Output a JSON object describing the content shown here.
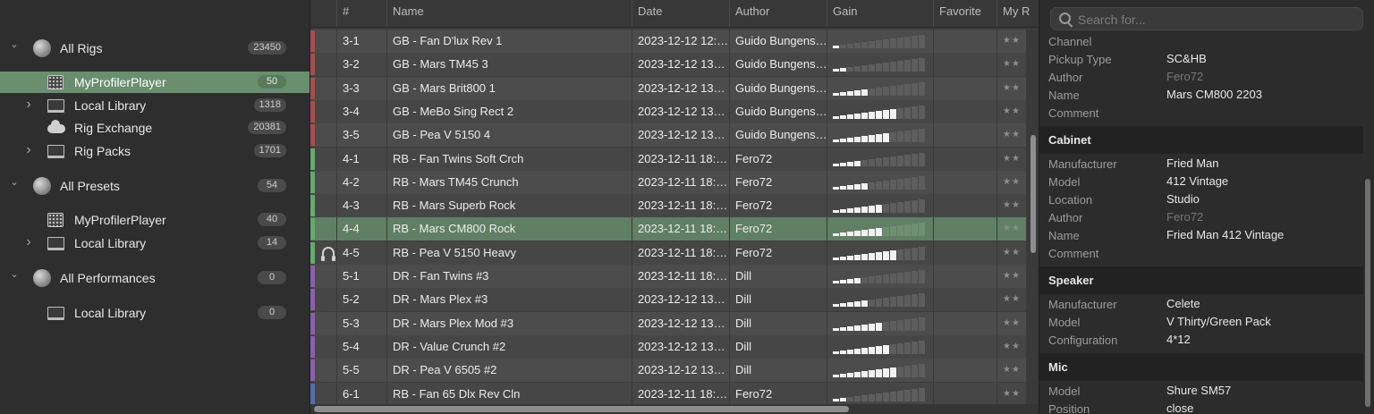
{
  "sidebar": {
    "items": [
      {
        "label": "All Rigs",
        "count": "23450",
        "icon": "globe-icon",
        "chevron": "down",
        "indent": 0,
        "selected": false
      },
      {
        "label": "MyProfilerPlayer",
        "count": "50",
        "icon": "profiler-device-icon",
        "chevron": "",
        "indent": 1,
        "selected": true
      },
      {
        "label": "Local Library",
        "count": "1318",
        "icon": "laptop-icon",
        "chevron": "right",
        "indent": 1,
        "selected": false
      },
      {
        "label": "Rig Exchange",
        "count": "20381",
        "icon": "cloud-icon",
        "chevron": "",
        "indent": 1,
        "selected": false
      },
      {
        "label": "Rig Packs",
        "count": "1701",
        "icon": "laptop-icon",
        "chevron": "right",
        "indent": 1,
        "selected": false
      },
      {
        "label": "All Presets",
        "count": "54",
        "icon": "globe-icon",
        "chevron": "down",
        "indent": 0,
        "selected": false
      },
      {
        "label": "MyProfilerPlayer",
        "count": "40",
        "icon": "profiler-device-icon",
        "chevron": "",
        "indent": 1,
        "selected": false
      },
      {
        "label": "Local Library",
        "count": "14",
        "icon": "laptop-icon",
        "chevron": "right",
        "indent": 1,
        "selected": false
      },
      {
        "label": "All Performances",
        "count": "0",
        "icon": "globe-icon",
        "chevron": "down",
        "indent": 0,
        "selected": false
      },
      {
        "label": "Local Library",
        "count": "0",
        "icon": "laptop-icon",
        "chevron": "",
        "indent": 1,
        "selected": false
      }
    ]
  },
  "table": {
    "columns": [
      "#",
      "Name",
      "Date",
      "Author",
      "Gain",
      "Favorite",
      "My R"
    ],
    "rows": [
      {
        "num": "3-1",
        "name": "GB - Fan D'lux Rev 1",
        "date": "2023-12-12 12:…",
        "author": "Guido Bungens…",
        "gain": 0.1,
        "color": "#b04a4a",
        "selected": false,
        "icon": ""
      },
      {
        "num": "3-2",
        "name": "GB - Mars TM45 3",
        "date": "2023-12-12 13…",
        "author": "Guido Bungens…",
        "gain": 0.18,
        "color": "#b04a4a",
        "selected": false,
        "icon": ""
      },
      {
        "num": "3-3",
        "name": "GB - Mars Brit800 1",
        "date": "2023-12-12 13…",
        "author": "Guido Bungens…",
        "gain": 0.4,
        "color": "#b04a4a",
        "selected": false,
        "icon": ""
      },
      {
        "num": "3-4",
        "name": "GB - MeBo Sing Rect 2",
        "date": "2023-12-12 13…",
        "author": "Guido Bungens…",
        "gain": 0.7,
        "color": "#b04a4a",
        "selected": false,
        "icon": ""
      },
      {
        "num": "3-5",
        "name": "GB - Pea V 5150 4",
        "date": "2023-12-12 13…",
        "author": "Guido Bungens…",
        "gain": 0.62,
        "color": "#b04a4a",
        "selected": false,
        "icon": ""
      },
      {
        "num": "4-1",
        "name": "RB - Fan Twins Soft Crch",
        "date": "2023-12-11 18:…",
        "author": "Fero72",
        "gain": 0.3,
        "color": "#5fae6a",
        "selected": false,
        "icon": ""
      },
      {
        "num": "4-2",
        "name": "RB - Mars TM45 Crunch",
        "date": "2023-12-11 18:…",
        "author": "Fero72",
        "gain": 0.4,
        "color": "#5fae6a",
        "selected": false,
        "icon": ""
      },
      {
        "num": "4-3",
        "name": "RB - Mars Superb Rock",
        "date": "2023-12-11 18:…",
        "author": "Fero72",
        "gain": 0.5,
        "color": "#5fae6a",
        "selected": false,
        "icon": ""
      },
      {
        "num": "4-4",
        "name": "RB - Mars CM800 Rock",
        "date": "2023-12-11 18:…",
        "author": "Fero72",
        "gain": 0.55,
        "color": "#5fae6a",
        "selected": true,
        "icon": ""
      },
      {
        "num": "4-5",
        "name": "RB - Pea V 5150 Heavy",
        "date": "2023-12-11 18:…",
        "author": "Fero72",
        "gain": 0.72,
        "color": "#5fae6a",
        "selected": false,
        "icon": "headphones-icon"
      },
      {
        "num": "5-1",
        "name": "DR - Fan Twins #3",
        "date": "2023-12-11 18:…",
        "author": "Dill",
        "gain": 0.3,
        "color": "#8a5fb0",
        "selected": false,
        "icon": ""
      },
      {
        "num": "5-2",
        "name": "DR - Mars Plex #3",
        "date": "2023-12-12 13…",
        "author": "Dill",
        "gain": 0.4,
        "color": "#8a5fb0",
        "selected": false,
        "icon": ""
      },
      {
        "num": "5-3",
        "name": "DR - Mars Plex Mod #3",
        "date": "2023-12-12 13…",
        "author": "Dill",
        "gain": 0.5,
        "color": "#8a5fb0",
        "selected": false,
        "icon": ""
      },
      {
        "num": "5-4",
        "name": "DR - Value Crunch #2",
        "date": "2023-12-12 13…",
        "author": "Dill",
        "gain": 0.6,
        "color": "#8a5fb0",
        "selected": false,
        "icon": ""
      },
      {
        "num": "5-5",
        "name": "DR - Pea V 6505 #2",
        "date": "2023-12-12 13…",
        "author": "Dill",
        "gain": 0.7,
        "color": "#8a5fb0",
        "selected": false,
        "icon": ""
      },
      {
        "num": "6-1",
        "name": "RB - Fan 65 Dlx Rev Cln",
        "date": "2023-12-11 18:…",
        "author": "Fero72",
        "gain": 0.15,
        "color": "#4f6fb0",
        "selected": false,
        "icon": ""
      }
    ]
  },
  "panel": {
    "search_placeholder": "Search for...",
    "entries": [
      {
        "type": "prop",
        "key": "Channel",
        "value": "",
        "dim": false
      },
      {
        "type": "prop",
        "key": "Pickup Type",
        "value": "SC&HB",
        "dim": false
      },
      {
        "type": "prop",
        "key": "Author",
        "value": "Fero72",
        "dim": true
      },
      {
        "type": "prop",
        "key": "Name",
        "value": "Mars CM800 2203",
        "dim": false
      },
      {
        "type": "prop",
        "key": "Comment",
        "value": "",
        "dim": false
      },
      {
        "type": "section",
        "title": "Cabinet"
      },
      {
        "type": "prop",
        "key": "Manufacturer",
        "value": "Fried Man",
        "dim": false
      },
      {
        "type": "prop",
        "key": "Model",
        "value": "412 Vintage",
        "dim": false
      },
      {
        "type": "prop",
        "key": "Location",
        "value": "Studio",
        "dim": false
      },
      {
        "type": "prop",
        "key": "Author",
        "value": "Fero72",
        "dim": true
      },
      {
        "type": "prop",
        "key": "Name",
        "value": "Fried Man 412 Vintage",
        "dim": false
      },
      {
        "type": "prop",
        "key": "Comment",
        "value": "",
        "dim": false
      },
      {
        "type": "section",
        "title": "Speaker"
      },
      {
        "type": "prop",
        "key": "Manufacturer",
        "value": "Celete",
        "dim": false
      },
      {
        "type": "prop",
        "key": "Model",
        "value": "V Thirty/Green Pack",
        "dim": false
      },
      {
        "type": "prop",
        "key": "Configuration",
        "value": "4*12",
        "dim": false
      },
      {
        "type": "section",
        "title": "Mic"
      },
      {
        "type": "prop",
        "key": "Model",
        "value": "Shure SM57",
        "dim": false
      },
      {
        "type": "prop",
        "key": "Position",
        "value": "close",
        "dim": false
      }
    ]
  },
  "colors": {
    "selection": "#607f64",
    "sidebar_selection": "#6a8f6e"
  }
}
